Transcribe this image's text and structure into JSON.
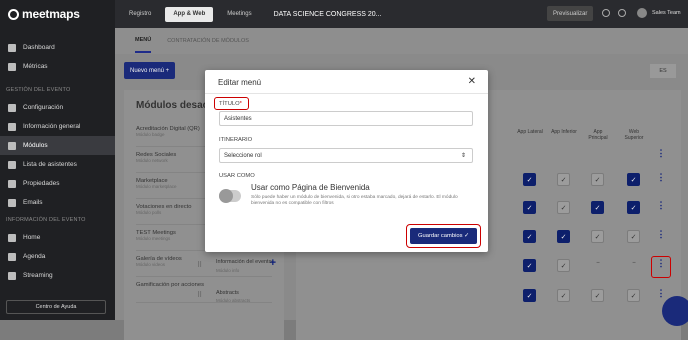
{
  "brand": {
    "name": "meetmaps"
  },
  "sidebar": {
    "items_top": [
      {
        "label": "Dashboard",
        "icon": "dashboard-icon"
      },
      {
        "label": "Métricas",
        "icon": "metrics-icon"
      }
    ],
    "section1": "GESTIÓN DEL EVENTO",
    "items_mid": [
      {
        "label": "Configuración",
        "icon": "gear-icon"
      },
      {
        "label": "Información general",
        "icon": "info-icon"
      },
      {
        "label": "Módulos",
        "icon": "modules-icon"
      },
      {
        "label": "Lista de asistentes",
        "icon": "users-icon"
      },
      {
        "label": "Propiedades",
        "icon": "properties-icon"
      },
      {
        "label": "Emails",
        "icon": "mail-icon"
      }
    ],
    "section2": "INFORMACIÓN DEL EVENTO",
    "items_bottom": [
      {
        "label": "Home",
        "icon": "home-icon"
      },
      {
        "label": "Agenda",
        "icon": "calendar-icon"
      },
      {
        "label": "Streaming",
        "icon": "streaming-icon"
      }
    ],
    "help": "Centro de Ayuda"
  },
  "topbar": {
    "tabs": [
      "Registro",
      "App & Web",
      "Meetings"
    ],
    "event_title": "DATA SCIENCE CONGRESS 20...",
    "preview": "Previsualizar",
    "user": "Sales Team"
  },
  "subtabs": [
    "MENÚ",
    "CONTRATACIÓN DE MÓDULOS"
  ],
  "new_menu": "Nuevo menú  +",
  "lang": "ES",
  "left_panel": {
    "title": "Módulos desactiv",
    "modules": [
      {
        "name": "Acreditación Digital (QR)",
        "sub": "Módulo badge"
      },
      {
        "name": "Redes Sociales",
        "sub": "Módulo network"
      },
      {
        "name": "Marketplace",
        "sub": "Módulo marketplace"
      },
      {
        "name": "Votaciones en directo",
        "sub": "Módulo polls"
      },
      {
        "name": "TEST Meetings",
        "sub": "Módulo meetings"
      },
      {
        "name": "Galería de vídeos",
        "sub": "Módulo videos"
      },
      {
        "name": "Gamificación por acciones",
        "sub": ""
      }
    ]
  },
  "right_panel": {
    "columns": [
      "App Lateral",
      "App Inferior",
      "App Principal",
      "Web Superior"
    ],
    "rows": [
      {
        "name": "",
        "sub": "",
        "checks": [
          true,
          false,
          false,
          true
        ]
      },
      {
        "name": "",
        "sub": "",
        "checks": [
          true,
          false,
          true,
          true
        ]
      },
      {
        "name": "",
        "sub": "",
        "checks": [
          true,
          true,
          false,
          false
        ]
      },
      {
        "name": "",
        "sub": "",
        "checks": [
          true,
          true,
          false,
          false
        ]
      },
      {
        "name": "Información del evento",
        "sub": "Módulo info",
        "checks": [
          true,
          false,
          null,
          null
        ]
      },
      {
        "name": "Abstracts",
        "sub": "Módulo abstracts",
        "checks": [
          true,
          false,
          false,
          false
        ]
      }
    ]
  },
  "modal": {
    "title": "Editar menú",
    "titulo_label": "TÍTULO",
    "titulo_req": "*",
    "titulo_value": "Asistentes",
    "itinerario_label": "ITINERARIO",
    "itinerario_value": "Seleccione rol",
    "usar_label": "USAR COMO",
    "welcome_title": "Usar como Página de Bienvenida",
    "welcome_desc": "Sólo puede haber un módulo de bienvenida, si otro estaba marcado, dejará de estarlo. El módulo bienvenida no es compatible con filtros",
    "save": "Guardar cambios ✓"
  }
}
